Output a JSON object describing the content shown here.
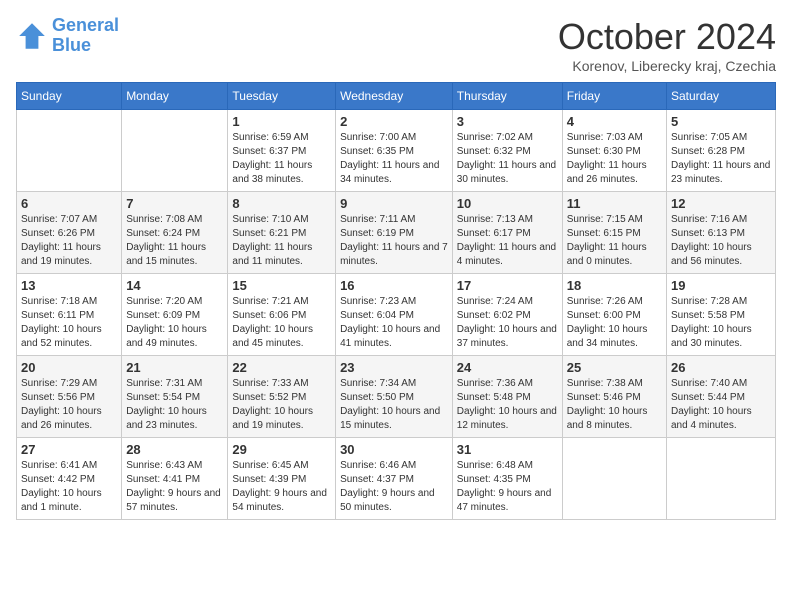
{
  "header": {
    "logo_line1": "General",
    "logo_line2": "Blue",
    "month_title": "October 2024",
    "subtitle": "Korenov, Liberecky kraj, Czechia"
  },
  "days_of_week": [
    "Sunday",
    "Monday",
    "Tuesday",
    "Wednesday",
    "Thursday",
    "Friday",
    "Saturday"
  ],
  "weeks": [
    [
      {
        "day": "",
        "info": ""
      },
      {
        "day": "",
        "info": ""
      },
      {
        "day": "1",
        "info": "Sunrise: 6:59 AM\nSunset: 6:37 PM\nDaylight: 11 hours and 38 minutes."
      },
      {
        "day": "2",
        "info": "Sunrise: 7:00 AM\nSunset: 6:35 PM\nDaylight: 11 hours and 34 minutes."
      },
      {
        "day": "3",
        "info": "Sunrise: 7:02 AM\nSunset: 6:32 PM\nDaylight: 11 hours and 30 minutes."
      },
      {
        "day": "4",
        "info": "Sunrise: 7:03 AM\nSunset: 6:30 PM\nDaylight: 11 hours and 26 minutes."
      },
      {
        "day": "5",
        "info": "Sunrise: 7:05 AM\nSunset: 6:28 PM\nDaylight: 11 hours and 23 minutes."
      }
    ],
    [
      {
        "day": "6",
        "info": "Sunrise: 7:07 AM\nSunset: 6:26 PM\nDaylight: 11 hours and 19 minutes."
      },
      {
        "day": "7",
        "info": "Sunrise: 7:08 AM\nSunset: 6:24 PM\nDaylight: 11 hours and 15 minutes."
      },
      {
        "day": "8",
        "info": "Sunrise: 7:10 AM\nSunset: 6:21 PM\nDaylight: 11 hours and 11 minutes."
      },
      {
        "day": "9",
        "info": "Sunrise: 7:11 AM\nSunset: 6:19 PM\nDaylight: 11 hours and 7 minutes."
      },
      {
        "day": "10",
        "info": "Sunrise: 7:13 AM\nSunset: 6:17 PM\nDaylight: 11 hours and 4 minutes."
      },
      {
        "day": "11",
        "info": "Sunrise: 7:15 AM\nSunset: 6:15 PM\nDaylight: 11 hours and 0 minutes."
      },
      {
        "day": "12",
        "info": "Sunrise: 7:16 AM\nSunset: 6:13 PM\nDaylight: 10 hours and 56 minutes."
      }
    ],
    [
      {
        "day": "13",
        "info": "Sunrise: 7:18 AM\nSunset: 6:11 PM\nDaylight: 10 hours and 52 minutes."
      },
      {
        "day": "14",
        "info": "Sunrise: 7:20 AM\nSunset: 6:09 PM\nDaylight: 10 hours and 49 minutes."
      },
      {
        "day": "15",
        "info": "Sunrise: 7:21 AM\nSunset: 6:06 PM\nDaylight: 10 hours and 45 minutes."
      },
      {
        "day": "16",
        "info": "Sunrise: 7:23 AM\nSunset: 6:04 PM\nDaylight: 10 hours and 41 minutes."
      },
      {
        "day": "17",
        "info": "Sunrise: 7:24 AM\nSunset: 6:02 PM\nDaylight: 10 hours and 37 minutes."
      },
      {
        "day": "18",
        "info": "Sunrise: 7:26 AM\nSunset: 6:00 PM\nDaylight: 10 hours and 34 minutes."
      },
      {
        "day": "19",
        "info": "Sunrise: 7:28 AM\nSunset: 5:58 PM\nDaylight: 10 hours and 30 minutes."
      }
    ],
    [
      {
        "day": "20",
        "info": "Sunrise: 7:29 AM\nSunset: 5:56 PM\nDaylight: 10 hours and 26 minutes."
      },
      {
        "day": "21",
        "info": "Sunrise: 7:31 AM\nSunset: 5:54 PM\nDaylight: 10 hours and 23 minutes."
      },
      {
        "day": "22",
        "info": "Sunrise: 7:33 AM\nSunset: 5:52 PM\nDaylight: 10 hours and 19 minutes."
      },
      {
        "day": "23",
        "info": "Sunrise: 7:34 AM\nSunset: 5:50 PM\nDaylight: 10 hours and 15 minutes."
      },
      {
        "day": "24",
        "info": "Sunrise: 7:36 AM\nSunset: 5:48 PM\nDaylight: 10 hours and 12 minutes."
      },
      {
        "day": "25",
        "info": "Sunrise: 7:38 AM\nSunset: 5:46 PM\nDaylight: 10 hours and 8 minutes."
      },
      {
        "day": "26",
        "info": "Sunrise: 7:40 AM\nSunset: 5:44 PM\nDaylight: 10 hours and 4 minutes."
      }
    ],
    [
      {
        "day": "27",
        "info": "Sunrise: 6:41 AM\nSunset: 4:42 PM\nDaylight: 10 hours and 1 minute."
      },
      {
        "day": "28",
        "info": "Sunrise: 6:43 AM\nSunset: 4:41 PM\nDaylight: 9 hours and 57 minutes."
      },
      {
        "day": "29",
        "info": "Sunrise: 6:45 AM\nSunset: 4:39 PM\nDaylight: 9 hours and 54 minutes."
      },
      {
        "day": "30",
        "info": "Sunrise: 6:46 AM\nSunset: 4:37 PM\nDaylight: 9 hours and 50 minutes."
      },
      {
        "day": "31",
        "info": "Sunrise: 6:48 AM\nSunset: 4:35 PM\nDaylight: 9 hours and 47 minutes."
      },
      {
        "day": "",
        "info": ""
      },
      {
        "day": "",
        "info": ""
      }
    ]
  ]
}
